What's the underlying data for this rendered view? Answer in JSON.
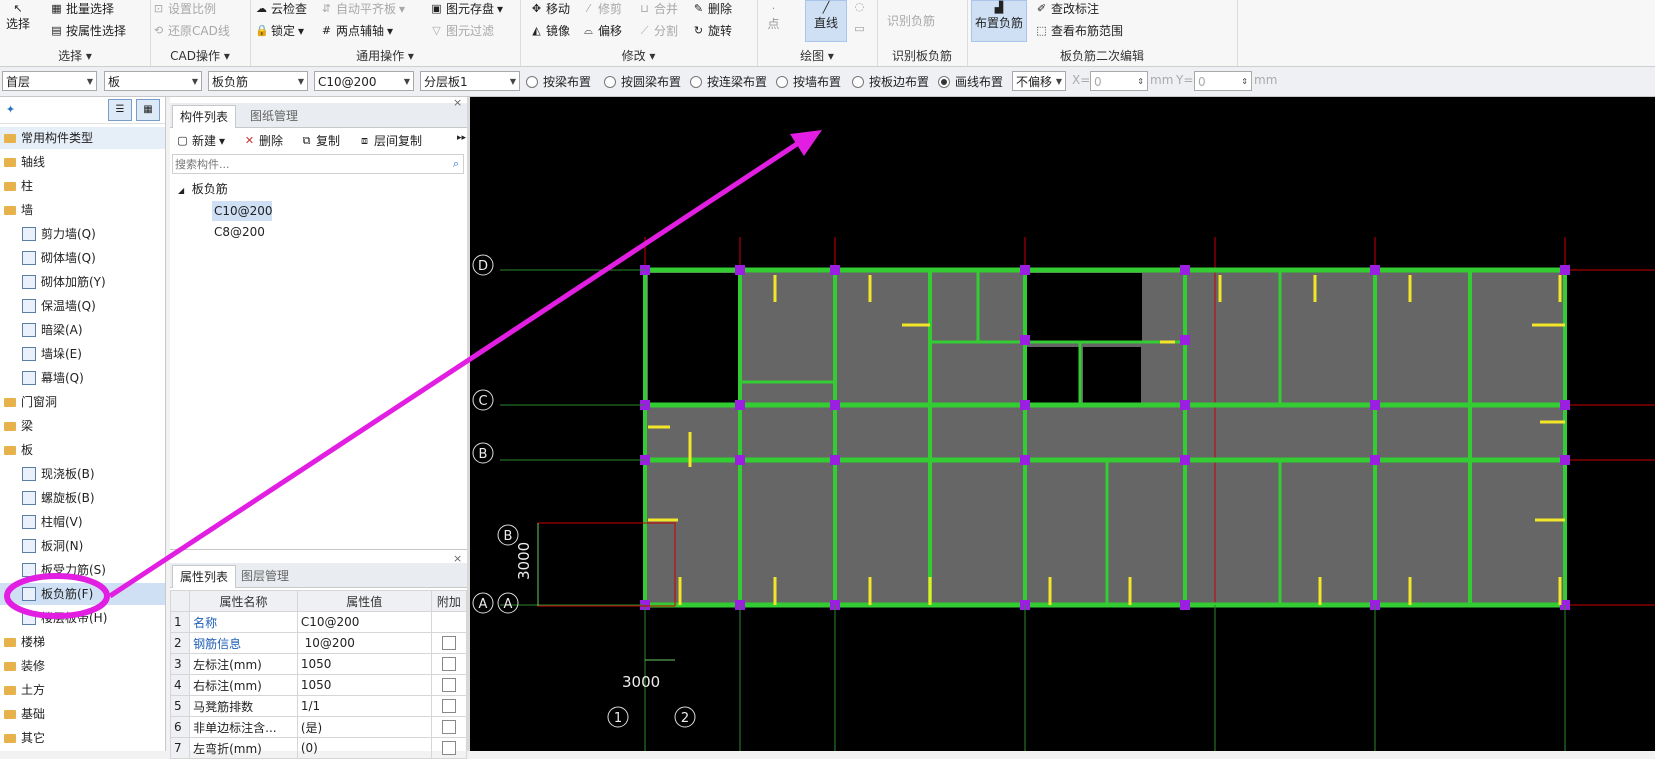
{
  "ribbon": {
    "groups": [
      {
        "title": "选择",
        "big": "选择",
        "items": [
          "批量选择",
          "按属性选择"
        ]
      },
      {
        "title": "CAD操作",
        "items": [
          "设置比例",
          "还原CAD线"
        ]
      },
      {
        "title": "通用操作",
        "items": [
          "云检查",
          "自动平齐板",
          "图元存盘",
          "锁定",
          "两点辅轴",
          "图元过滤"
        ]
      },
      {
        "title": "修改",
        "items": [
          "移动",
          "修剪",
          "合并",
          "删除",
          "镜像",
          "偏移",
          "分割",
          "旋转"
        ]
      },
      {
        "title": "绘图",
        "items": [
          "点",
          "直线"
        ]
      },
      {
        "title": "识别板负筋",
        "items": [
          "识别负筋"
        ]
      },
      {
        "title": "板负筋二次编辑",
        "big": "布置负筋",
        "items": [
          "查改标注",
          "查看布筋范围"
        ]
      }
    ]
  },
  "toolbar": {
    "floor": "首层",
    "category": "板",
    "type": "板负筋",
    "component": "C10@200",
    "layer": "分层板1",
    "radios": [
      "按梁布置",
      "按圆梁布置",
      "按连梁布置",
      "按墙布置",
      "按板边布置",
      "画线布置"
    ],
    "radio_selected": "画线布置",
    "offset": "不偏移",
    "x_label": "X=",
    "x_value": "0",
    "y_label": "Y=",
    "y_value": "0",
    "unit": "mm"
  },
  "tree": {
    "items": [
      {
        "label": "常用构件类型",
        "level": 0,
        "selected": true
      },
      {
        "label": "轴线",
        "level": 0
      },
      {
        "label": "柱",
        "level": 0
      },
      {
        "label": "墙",
        "level": 0
      },
      {
        "label": "剪力墙(Q)",
        "level": 1
      },
      {
        "label": "砌体墙(Q)",
        "level": 1
      },
      {
        "label": "砌体加筋(Y)",
        "level": 1
      },
      {
        "label": "保温墙(Q)",
        "level": 1
      },
      {
        "label": "暗梁(A)",
        "level": 1
      },
      {
        "label": "墙垛(E)",
        "level": 1
      },
      {
        "label": "幕墙(Q)",
        "level": 1
      },
      {
        "label": "门窗洞",
        "level": 0
      },
      {
        "label": "梁",
        "level": 0
      },
      {
        "label": "板",
        "level": 0
      },
      {
        "label": "现浇板(B)",
        "level": 1
      },
      {
        "label": "螺旋板(B)",
        "level": 1
      },
      {
        "label": "柱帽(V)",
        "level": 1
      },
      {
        "label": "板洞(N)",
        "level": 1
      },
      {
        "label": "板受力筋(S)",
        "level": 1
      },
      {
        "label": "板负筋(F)",
        "level": 1,
        "active": true
      },
      {
        "label": "楼层板带(H)",
        "level": 1
      },
      {
        "label": "楼梯",
        "level": 0
      },
      {
        "label": "装修",
        "level": 0
      },
      {
        "label": "土方",
        "level": 0
      },
      {
        "label": "基础",
        "level": 0
      },
      {
        "label": "其它",
        "level": 0
      }
    ]
  },
  "component_panel": {
    "tabs": [
      "构件列表",
      "图纸管理"
    ],
    "actions": [
      "新建",
      "删除",
      "复制",
      "层间复制"
    ],
    "search_placeholder": "搜索构件...",
    "group": "板负筋",
    "components": [
      "C10@200",
      "C8@200"
    ],
    "selected": "C10@200"
  },
  "property_panel": {
    "tabs": [
      "属性列表",
      "图层管理"
    ],
    "headers": [
      "属性名称",
      "属性值",
      "附加"
    ],
    "rows": [
      {
        "n": "1",
        "name": "名称",
        "value": "C10@200",
        "blue": true,
        "check": false
      },
      {
        "n": "2",
        "name": "钢筋信息",
        "value": " 10@200",
        "blue": true,
        "check": true
      },
      {
        "n": "3",
        "name": "左标注(mm)",
        "value": "1050",
        "check": true
      },
      {
        "n": "4",
        "name": "右标注(mm)",
        "value": "1050",
        "check": true
      },
      {
        "n": "5",
        "name": "马凳筋排数",
        "value": "1/1",
        "check": true
      },
      {
        "n": "6",
        "name": "非单边标注含...",
        "value": "(是)",
        "check": true
      },
      {
        "n": "7",
        "name": "左弯折(mm)",
        "value": "(0)",
        "check": true
      }
    ]
  },
  "cad": {
    "axis_labels": [
      "D",
      "C",
      "B",
      "A",
      "B",
      "A",
      "1",
      "2"
    ],
    "dimensions": [
      "3000",
      "3000"
    ]
  }
}
